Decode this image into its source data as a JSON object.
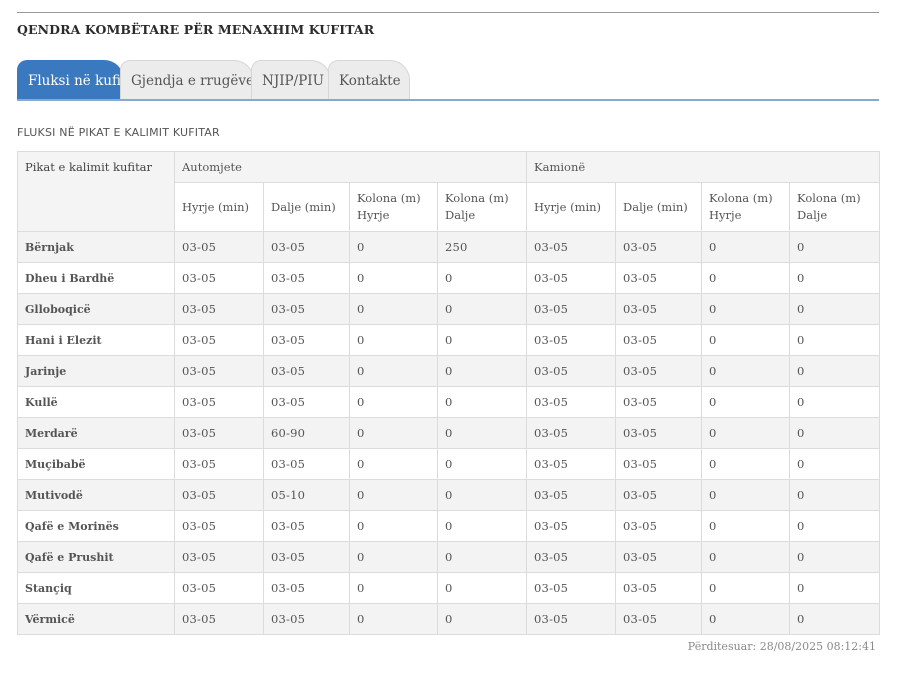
{
  "site": {
    "title": "QENDRA KOMBËTARE PËR MENAXHIM KUFITAR"
  },
  "tabs": [
    {
      "label": "Fluksi në kufi",
      "active": true
    },
    {
      "label": "Gjendja e rrugëve",
      "active": false
    },
    {
      "label": "NJIP/PIU",
      "active": false
    },
    {
      "label": "Kontakte",
      "active": false
    }
  ],
  "section_title": "FLUKSI NË PIKAT E KALIMIT KUFITAR",
  "table": {
    "col_pikat": "Pikat e kalimit kufitar",
    "group_auto": "Automjete",
    "group_kamion": "Kamionë",
    "subheaders": [
      "Hyrje (min)",
      "Dalje (min)",
      "Kolona (m) Hyrje",
      "Kolona (m) Dalje",
      "Hyrje (min)",
      "Dalje (min)",
      "Kolona (m) Hyrje",
      "Kolona (m) Dalje"
    ],
    "rows": [
      {
        "name": "Bërnjak",
        "values": [
          "03-05",
          "03-05",
          "0",
          "250",
          "03-05",
          "03-05",
          "0",
          "0"
        ]
      },
      {
        "name": "Dheu i Bardhë",
        "values": [
          "03-05",
          "03-05",
          "0",
          "0",
          "03-05",
          "03-05",
          "0",
          "0"
        ]
      },
      {
        "name": "Glloboqicë",
        "values": [
          "03-05",
          "03-05",
          "0",
          "0",
          "03-05",
          "03-05",
          "0",
          "0"
        ]
      },
      {
        "name": "Hani i Elezit",
        "values": [
          "03-05",
          "03-05",
          "0",
          "0",
          "03-05",
          "03-05",
          "0",
          "0"
        ]
      },
      {
        "name": "Jarinje",
        "values": [
          "03-05",
          "03-05",
          "0",
          "0",
          "03-05",
          "03-05",
          "0",
          "0"
        ]
      },
      {
        "name": "Kullë",
        "values": [
          "03-05",
          "03-05",
          "0",
          "0",
          "03-05",
          "03-05",
          "0",
          "0"
        ]
      },
      {
        "name": "Merdarë",
        "values": [
          "03-05",
          "60-90",
          "0",
          "0",
          "03-05",
          "03-05",
          "0",
          "0"
        ]
      },
      {
        "name": "Muçibabë",
        "values": [
          "03-05",
          "03-05",
          "0",
          "0",
          "03-05",
          "03-05",
          "0",
          "0"
        ]
      },
      {
        "name": "Mutivodë",
        "values": [
          "03-05",
          "05-10",
          "0",
          "0",
          "03-05",
          "03-05",
          "0",
          "0"
        ]
      },
      {
        "name": "Qafë e Morinës",
        "values": [
          "03-05",
          "03-05",
          "0",
          "0",
          "03-05",
          "03-05",
          "0",
          "0"
        ]
      },
      {
        "name": "Qafë e Prushit",
        "values": [
          "03-05",
          "03-05",
          "0",
          "0",
          "03-05",
          "03-05",
          "0",
          "0"
        ]
      },
      {
        "name": "Stançiq",
        "values": [
          "03-05",
          "03-05",
          "0",
          "0",
          "03-05",
          "03-05",
          "0",
          "0"
        ]
      },
      {
        "name": "Vërmicë",
        "values": [
          "03-05",
          "03-05",
          "0",
          "0",
          "03-05",
          "03-05",
          "0",
          "0"
        ]
      }
    ]
  },
  "updated": "Përditesuar: 28/08/2025 08:12:41",
  "colors": {
    "accent": "#3a78bf",
    "tab_inactive": "#ececec",
    "row_alt": "#f3f3f3"
  }
}
